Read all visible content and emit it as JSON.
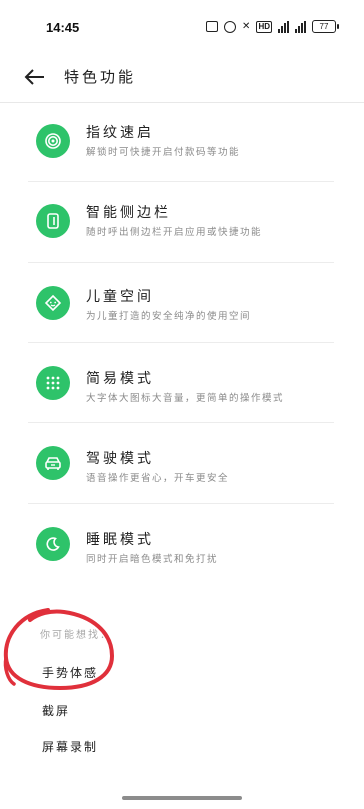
{
  "status_bar": {
    "time": "14:45",
    "battery": "77"
  },
  "header": {
    "title": "特色功能",
    "back_icon": "arrow-left-icon"
  },
  "features": [
    {
      "title": "指纹速启",
      "subtitle": "解锁时可快捷开启付款码等功能",
      "icon": "fingerprint-icon"
    },
    {
      "title": "智能侧边栏",
      "subtitle": "随时呼出侧边栏开启应用或快捷功能",
      "icon": "sidebar-icon"
    },
    {
      "title": "儿童空间",
      "subtitle": "为儿童打造的安全纯净的使用空间",
      "icon": "child-face-icon"
    },
    {
      "title": "简易模式",
      "subtitle": "大字体大图标大音量，更简单的操作模式",
      "icon": "grid-dots-icon"
    },
    {
      "title": "驾驶模式",
      "subtitle": "语音操作更省心，开车更安全",
      "icon": "car-icon"
    },
    {
      "title": "睡眠模式",
      "subtitle": "同时开启暗色模式和免打扰",
      "icon": "moon-icon"
    }
  ],
  "suggestions": {
    "label": "你可能想找：",
    "items": [
      "手势体感",
      "截屏",
      "屏幕录制"
    ]
  },
  "colors": {
    "accent_green": "#2ec36a",
    "annotation_red": "#e0303b"
  }
}
